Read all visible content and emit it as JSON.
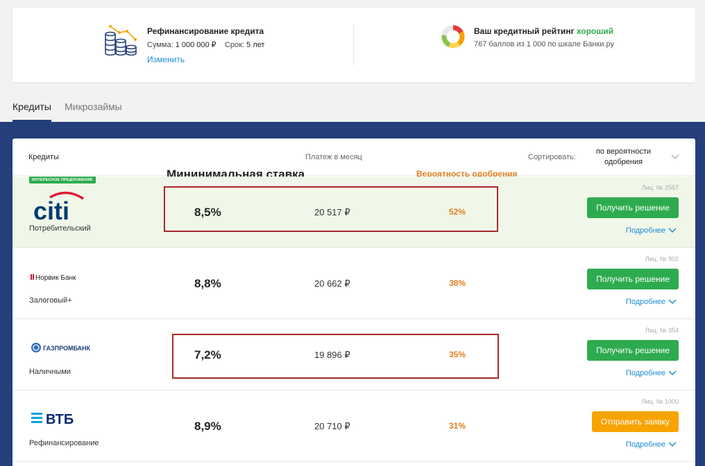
{
  "summary": {
    "loan": {
      "title": "Рефинансирование кредита",
      "sum_label": "Сумма:",
      "sum_value": "1 000 000 ₽",
      "term_label": "Срок:",
      "term_value": "5 лет",
      "change_link": "Изменить",
      "icon": "coins-chart-icon"
    },
    "rating": {
      "title": "Ваш кредитный рейтинг",
      "status": "хороший",
      "description": "767 баллов из 1 000 по шкале Банки.ру",
      "icon": "rating-donut-icon"
    }
  },
  "tabs": [
    {
      "label": "Кредиты",
      "active": true
    },
    {
      "label": "Микрозаймы",
      "active": false
    }
  ],
  "table": {
    "headers": {
      "product": "Кредиты",
      "rate": "Мининимальная ставка",
      "payment": "Платеж в месяц",
      "probability": "Вероятность одобрения",
      "sort_label": "Сортировать:",
      "sort_value": "по вероятности одобрения"
    },
    "rows": [
      {
        "badge": "интересное предложение",
        "bank": "citi",
        "product": "Потребительский",
        "rate": "8,5%",
        "payment": "20 517 ₽",
        "probability": "52%",
        "license": "Лиц. № 2557",
        "button": "Получить решение",
        "button_color": "#2eab4f",
        "more": "Подробнее"
      },
      {
        "bank": "Норвик Банк",
        "product": "Залоговый+",
        "rate": "8,8%",
        "payment": "20 662 ₽",
        "probability": "38%",
        "license": "Лиц. № 902",
        "button": "Получить решение",
        "button_color": "#2eab4f",
        "more": "Подробнее"
      },
      {
        "bank": "ГАЗПРОМБАНК",
        "product": "Наличными",
        "rate": "7,2%",
        "payment": "19 896 ₽",
        "probability": "35%",
        "license": "Лиц. № 354",
        "button": "Получить решение",
        "button_color": "#2eab4f",
        "more": "Подробнее"
      },
      {
        "bank": "ВТБ",
        "product": "Рефинансирование",
        "rate": "8,9%",
        "payment": "20 710 ₽",
        "probability": "31%",
        "license": "Лиц. № 1000",
        "button": "Отправить заявку",
        "button_color": "#f7a300",
        "more": "Подробнее"
      }
    ]
  },
  "colors": {
    "brand_blue": "#243f7a",
    "accent_green": "#2eab4f",
    "accent_orange": "#f7a300",
    "probability_orange": "#e07f1f",
    "link_blue": "#1a8ad4",
    "highlight_red": "#a52a2a",
    "highlight_row_bg": "#f0f7e9"
  }
}
